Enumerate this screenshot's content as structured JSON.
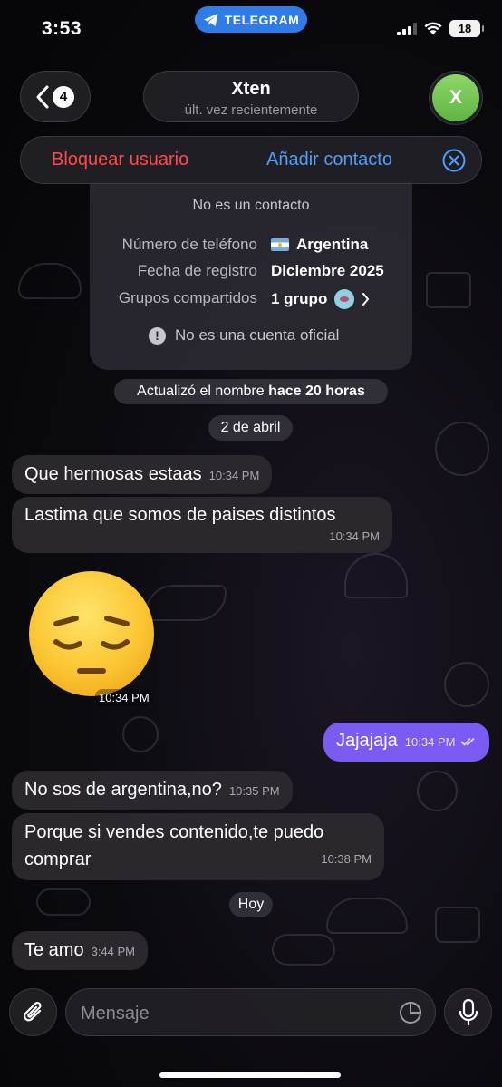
{
  "status_bar": {
    "time": "3:53",
    "app_pill": "TELEGRAM",
    "battery": "18"
  },
  "header": {
    "back_count": "4",
    "name": "Xten",
    "last_seen": "últ. vez recientemente",
    "avatar_letter": "X",
    "avatar_color": "#6cc24f"
  },
  "action_bar": {
    "block_label": "Bloquear usuario",
    "add_label": "Añadir contacto",
    "block_color": "#ff4b47",
    "add_color": "#4f9ef7"
  },
  "info_card": {
    "not_contact": "No es un contacto",
    "rows": [
      {
        "label": "Número de teléfono",
        "value": "Argentina"
      },
      {
        "label": "Fecha de registro",
        "value": "Diciembre 2025"
      },
      {
        "label": "Grupos compartidos",
        "value": "1 grupo"
      }
    ],
    "official_note": "No es una cuenta oficial"
  },
  "service": {
    "name_update_prefix": "Actualizó el nombre ",
    "name_update_bold": "hace 20 horas",
    "date_1": "2 de abril",
    "date_2": "Hoy"
  },
  "messages": [
    {
      "text": "Que hermosas estaas",
      "time": "10:34 PM",
      "direction": "in"
    },
    {
      "text": "Lastima que somos de paises distintos",
      "time": "10:34 PM",
      "direction": "in"
    },
    {
      "text": "😔",
      "time": "10:34 PM",
      "direction": "in",
      "kind": "emoji"
    },
    {
      "text": "Jajajaja",
      "time": "10:34 PM",
      "direction": "out",
      "status": "read"
    },
    {
      "text": "No sos de argentina,no?",
      "time": "10:35 PM",
      "direction": "in"
    },
    {
      "text": "Porque si vendes contenido,te puedo comprar",
      "time": "10:38 PM",
      "direction": "in"
    },
    {
      "text": "Te amo",
      "time": "3:44 PM",
      "direction": "in"
    }
  ],
  "composer": {
    "placeholder": "Mensaje",
    "attach_icon": "paperclip-icon",
    "sticker_icon": "sticker-icon",
    "mic_icon": "microphone-icon"
  },
  "colors": {
    "outgoing_bubble": "#7b5cf2",
    "incoming_bubble": "#2b282d",
    "telegram_blue": "#2f7ce8"
  }
}
